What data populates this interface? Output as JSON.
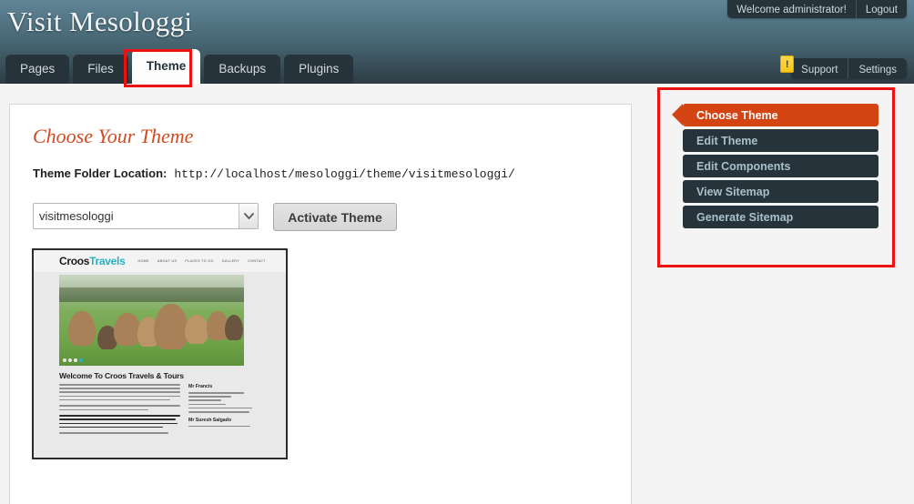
{
  "header": {
    "site_title": "Visit Mesologgi",
    "welcome_text": "Welcome administrator!",
    "logout_label": "Logout",
    "support_label": "Support",
    "settings_label": "Settings",
    "alert_badge": "!",
    "tabs": [
      {
        "label": "Pages",
        "active": false
      },
      {
        "label": "Files",
        "active": false
      },
      {
        "label": "Theme",
        "active": true
      },
      {
        "label": "Backups",
        "active": false
      },
      {
        "label": "Plugins",
        "active": false
      }
    ]
  },
  "main": {
    "page_title": "Choose Your Theme",
    "folder_label": "Theme Folder Location:",
    "folder_path": "http://localhost/mesologgi/theme/visitmesologgi/",
    "theme_select": {
      "selected": "visitmesologgi",
      "options": [
        "visitmesologgi"
      ]
    },
    "activate_button": "Activate Theme"
  },
  "preview": {
    "logo_first": "Croos",
    "logo_second": "Travels",
    "nav": [
      "HOME",
      "ABOUT US",
      "PLACES TO GO",
      "GALLERY",
      "CONTACT"
    ],
    "slider_dots": 4,
    "slider_active_index": 3,
    "body_heading": "Welcome To Croos Travels & Tours",
    "sidebar_heading_1": "Mr Francis",
    "sidebar_heading_2": "Mr Suresh Salgado"
  },
  "sidebar": {
    "items": [
      {
        "label": "Choose Theme",
        "active": true
      },
      {
        "label": "Edit Theme",
        "active": false
      },
      {
        "label": "Edit Components",
        "active": false
      },
      {
        "label": "View Sitemap",
        "active": false
      },
      {
        "label": "Generate Sitemap",
        "active": false
      }
    ]
  },
  "colors": {
    "accent_orange": "#d44413",
    "header_dark": "#26333a",
    "title_orange": "#d24a22",
    "annotation_red": "#ee1111",
    "logo_teal": "#2ab0c4",
    "badge_yellow": "#f5c518"
  }
}
